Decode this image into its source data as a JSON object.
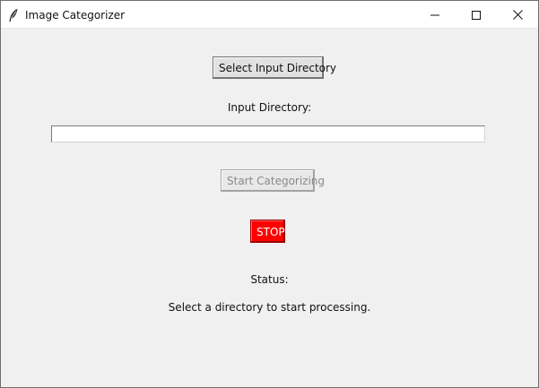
{
  "window": {
    "title": "Image Categorizer",
    "controls": {
      "minimize_icon": "minimize-icon",
      "maximize_icon": "maximize-icon",
      "close_icon": "close-icon"
    }
  },
  "main": {
    "select_button_label": "Select Input Directory",
    "input_directory_label": "Input Directory:",
    "input_directory_value": "",
    "start_button_label": "Start Categorizing",
    "start_button_enabled": false,
    "stop_button_label": "STOP",
    "status_label": "Status:",
    "status_message": "Select a directory to start processing."
  },
  "colors": {
    "window_bg": "#f0f0f0",
    "titlebar_bg": "#ffffff",
    "stop_bg": "#ff0000",
    "stop_fg": "#ffffff",
    "disabled_text": "#8a8a8a"
  }
}
